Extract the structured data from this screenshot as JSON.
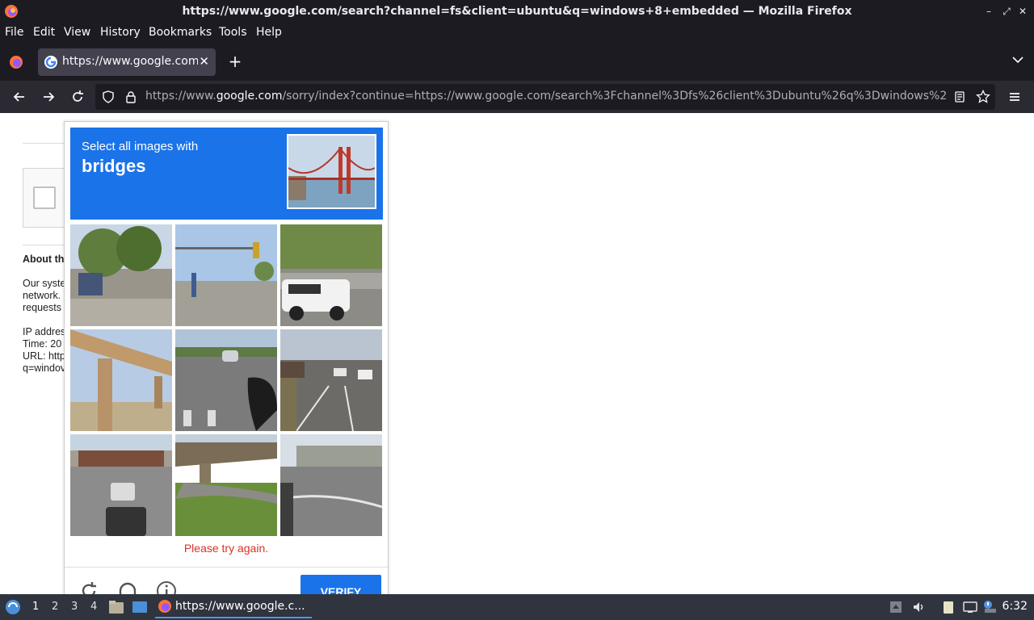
{
  "window": {
    "title": "https://www.google.com/search?channel=fs&client=ubuntu&q=windows+8+embedded — Mozilla Firefox",
    "min": "–",
    "max": "⤢",
    "close": "✕"
  },
  "menu": {
    "file": "File",
    "edit": "Edit",
    "view": "View",
    "history": "History",
    "bookmarks": "Bookmarks",
    "tools": "Tools",
    "help": "Help"
  },
  "tab": {
    "label": "https://www.google.com/",
    "close": "✕",
    "new": "+"
  },
  "address": {
    "prefix": "https://www.",
    "domain": "google.com",
    "suffix": "/sorry/index?continue=https://www.google.com/search%3Fchannel%3Dfs%26client%3Dubuntu%26q%3Dwindows%2"
  },
  "background_page": {
    "heading": "About th",
    "line1": "Our syste",
    "line2": "network.",
    "line3": "requests",
    "ip": "IP addres",
    "time": "Time: 20",
    "url1": "URL: http",
    "url2": "q=windov"
  },
  "captcha": {
    "instruction": "Select all images with",
    "target": "bridges",
    "error": "Please try again.",
    "verify": "VERIFY",
    "tiles": [
      "street-trees-bus",
      "intersection-traffic-light",
      "white-suv-hill",
      "concrete-overpass-pillar",
      "road-cars",
      "town-road-traffic",
      "underpass-cars",
      "overpass-grass",
      "curved-road-building"
    ]
  },
  "taskbar": {
    "ws1": "1",
    "ws2": "2",
    "ws3": "3",
    "ws4": "4",
    "task": "https://www.google.c...",
    "clock": "6:32"
  },
  "colors": {
    "accent": "#1a73e8",
    "error": "#d93025",
    "chrome": "#1c1b22"
  }
}
